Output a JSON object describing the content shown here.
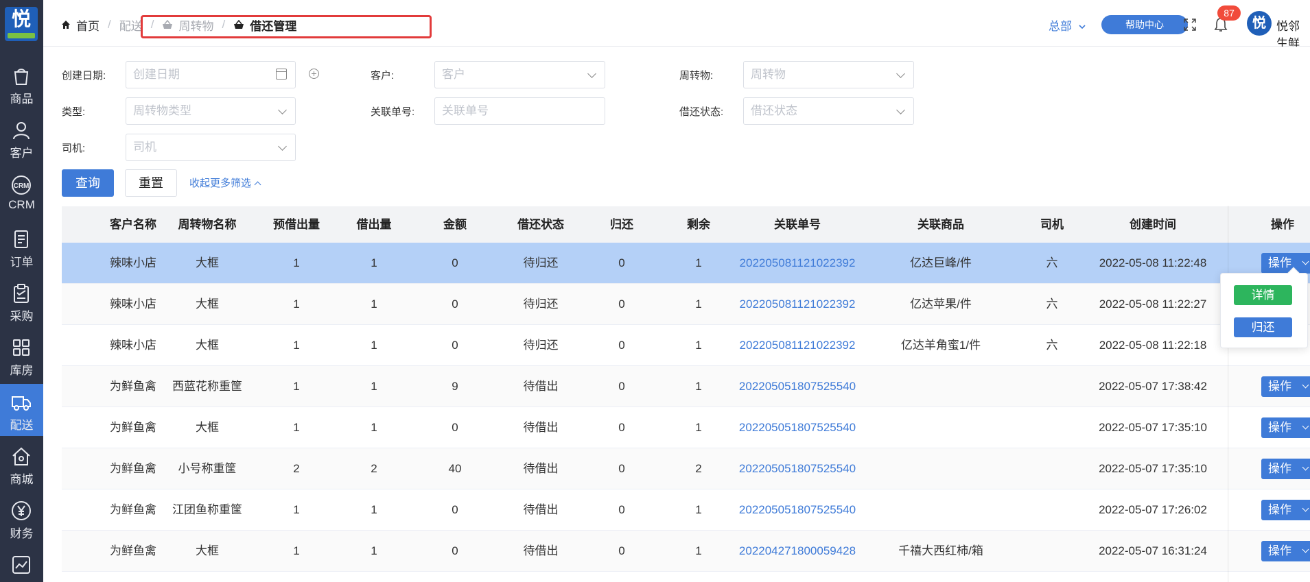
{
  "sidebar": {
    "logo_char": "悦",
    "items": [
      {
        "label": "商品",
        "icon": "bag-icon"
      },
      {
        "label": "客户",
        "icon": "person-icon"
      },
      {
        "label": "CRM",
        "icon": "crm-icon"
      },
      {
        "label": "订单",
        "icon": "document-icon"
      },
      {
        "label": "采购",
        "icon": "clipboard-icon"
      },
      {
        "label": "库房",
        "icon": "grid-icon"
      },
      {
        "label": "配送",
        "icon": "truck-icon"
      },
      {
        "label": "商城",
        "icon": "home-icon"
      },
      {
        "label": "财务",
        "icon": "yen-icon"
      }
    ],
    "active_label": "配送"
  },
  "header": {
    "breadcrumb": [
      "首页",
      "配送",
      "周转物",
      "借还管理"
    ],
    "org": "总部",
    "help": "帮助中心",
    "notification_count": "87",
    "avatar_char": "悦",
    "username": "悦邻生鲜"
  },
  "filters": {
    "created_date": {
      "label": "创建日期:",
      "placeholder": "创建日期"
    },
    "customer": {
      "label": "客户:",
      "placeholder": "客户"
    },
    "item": {
      "label": "周转物:",
      "placeholder": "周转物"
    },
    "type": {
      "label": "类型:",
      "placeholder": "周转物类型"
    },
    "order_no": {
      "label": "关联单号:",
      "placeholder": "关联单号"
    },
    "status": {
      "label": "借还状态:",
      "placeholder": "借还状态"
    },
    "driver": {
      "label": "司机:",
      "placeholder": "司机"
    },
    "query": "查询",
    "reset": "重置",
    "collapse": "收起更多筛选"
  },
  "table": {
    "columns": [
      "客户名称",
      "周转物名称",
      "预借出量",
      "借出量",
      "金额",
      "借还状态",
      "归还",
      "剩余",
      "关联单号",
      "关联商品",
      "司机",
      "创建时间",
      "操作"
    ],
    "op_label": "操作",
    "rows": [
      {
        "customer": "辣味小店",
        "item": "大框",
        "plan": "1",
        "lent": "1",
        "amount": "0",
        "status": "待归还",
        "returned": "0",
        "remain": "1",
        "order": "202205081121022392",
        "product": "亿达巨峰/件",
        "driver": "六",
        "time": "2022-05-08 11:22:48"
      },
      {
        "customer": "辣味小店",
        "item": "大框",
        "plan": "1",
        "lent": "1",
        "amount": "0",
        "status": "待归还",
        "returned": "0",
        "remain": "1",
        "order": "202205081121022392",
        "product": "亿达苹果/件",
        "driver": "六",
        "time": "2022-05-08 11:22:27"
      },
      {
        "customer": "辣味小店",
        "item": "大框",
        "plan": "1",
        "lent": "1",
        "amount": "0",
        "status": "待归还",
        "returned": "0",
        "remain": "1",
        "order": "202205081121022392",
        "product": "亿达羊角蜜1/件",
        "driver": "六",
        "time": "2022-05-08 11:22:18"
      },
      {
        "customer": "为鲜鱼禽",
        "item": "西蓝花称重筐",
        "plan": "1",
        "lent": "1",
        "amount": "9",
        "status": "待借出",
        "returned": "0",
        "remain": "1",
        "order": "202205051807525540",
        "product": "",
        "driver": "",
        "time": "2022-05-07 17:38:42"
      },
      {
        "customer": "为鲜鱼禽",
        "item": "大框",
        "plan": "1",
        "lent": "1",
        "amount": "0",
        "status": "待借出",
        "returned": "0",
        "remain": "1",
        "order": "202205051807525540",
        "product": "",
        "driver": "",
        "time": "2022-05-07 17:35:10"
      },
      {
        "customer": "为鲜鱼禽",
        "item": "小号称重筐",
        "plan": "2",
        "lent": "2",
        "amount": "40",
        "status": "待借出",
        "returned": "0",
        "remain": "2",
        "order": "202205051807525540",
        "product": "",
        "driver": "",
        "time": "2022-05-07 17:35:10"
      },
      {
        "customer": "为鲜鱼禽",
        "item": "江团鱼称重筐",
        "plan": "1",
        "lent": "1",
        "amount": "0",
        "status": "待借出",
        "returned": "0",
        "remain": "1",
        "order": "202205051807525540",
        "product": "",
        "driver": "",
        "time": "2022-05-07 17:26:02"
      },
      {
        "customer": "为鲜鱼禽",
        "item": "大框",
        "plan": "1",
        "lent": "1",
        "amount": "0",
        "status": "待借出",
        "returned": "0",
        "remain": "1",
        "order": "202204271800059428",
        "product": "千禧大西红柿/箱",
        "driver": "",
        "time": "2022-05-07 16:31:24"
      }
    ]
  },
  "dropdown": {
    "detail": "详情",
    "return": "归还"
  }
}
